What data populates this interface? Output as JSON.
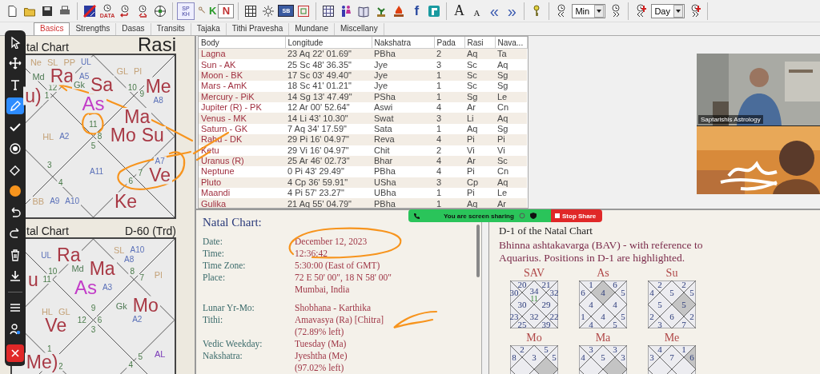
{
  "toolbar": [
    {
      "kind": "new"
    },
    {
      "kind": "open"
    },
    {
      "kind": "save"
    },
    {
      "kind": "print"
    },
    {
      "kind": "separator"
    },
    {
      "kind": "chart"
    },
    {
      "kind": "data",
      "label": "DATA"
    },
    {
      "kind": "clockarrow"
    },
    {
      "kind": "clockarrow2"
    },
    {
      "kind": "wheel"
    },
    {
      "kind": "separator"
    },
    {
      "kind": "badge",
      "label": "SP KH"
    },
    {
      "kind": "key-letter",
      "label": "K"
    },
    {
      "kind": "letter-box",
      "label": "N"
    },
    {
      "kind": "separator"
    },
    {
      "kind": "grid"
    },
    {
      "kind": "sun"
    },
    {
      "kind": "badge-blue",
      "label": "SB"
    },
    {
      "kind": "frame"
    },
    {
      "kind": "separator"
    },
    {
      "kind": "grid2"
    },
    {
      "kind": "people"
    },
    {
      "kind": "book"
    },
    {
      "kind": "plant"
    },
    {
      "kind": "fire"
    },
    {
      "kind": "letter",
      "label": "f"
    },
    {
      "kind": "tile"
    },
    {
      "kind": "separator"
    },
    {
      "kind": "font-large",
      "label": "A"
    },
    {
      "kind": "font-small",
      "label": "A"
    },
    {
      "kind": "chevron-text",
      "label": "«"
    },
    {
      "kind": "chevron-text",
      "label": "»"
    },
    {
      "kind": "separator"
    },
    {
      "kind": "key"
    },
    {
      "kind": "separator"
    },
    {
      "kind": "rewind"
    },
    {
      "kind": "dropdown",
      "value": "Min"
    },
    {
      "kind": "forward"
    },
    {
      "kind": "separator"
    },
    {
      "kind": "rewind-red"
    },
    {
      "kind": "dropdown",
      "value": "Day"
    },
    {
      "kind": "forward-red"
    },
    {
      "kind": "separator"
    }
  ],
  "tabs": [
    {
      "label": "Basics",
      "selected": true
    },
    {
      "label": "Strengths",
      "selected": false
    },
    {
      "label": "Dasas",
      "selected": false
    },
    {
      "label": "Transits",
      "selected": false
    },
    {
      "label": "Tajaka",
      "selected": false
    },
    {
      "label": "Tithi Pravesha",
      "selected": false
    },
    {
      "label": "Mundane",
      "selected": false
    },
    {
      "label": "Miscellany",
      "selected": false
    }
  ],
  "charts": [
    {
      "title": "tal Chart",
      "division": "Rasi",
      "kind": "rasi",
      "houses": [
        {
          "sign": "12",
          "labels": [
            {
              "text": "Ne",
              "kind": "point"
            },
            {
              "text": "SL",
              "kind": "point"
            },
            {
              "text": "PP",
              "kind": "point"
            },
            {
              "text": "UL",
              "kind": "arudha"
            },
            {
              "text": "Md",
              "kind": "upagraha"
            },
            {
              "text": "Ra",
              "kind": "planet"
            },
            {
              "text": "A5",
              "kind": "arudha"
            }
          ]
        },
        {
          "sign": "10",
          "labels": [
            {
              "text": "GL",
              "kind": "point"
            },
            {
              "text": "Pl",
              "kind": "point"
            }
          ]
        },
        {
          "sign": "1",
          "labels": [
            {
              "text": "u)",
              "kind": "planet"
            }
          ]
        },
        {
          "sign": "11",
          "labels": [
            {
              "text": "Gk",
              "kind": "upagraha"
            },
            {
              "text": "Sa",
              "kind": "planet"
            },
            {
              "text": "As",
              "kind": "lagna"
            }
          ]
        },
        {
          "sign": "9",
          "labels": [
            {
              "text": "Me",
              "kind": "planet"
            },
            {
              "text": "A8",
              "kind": "arudha"
            }
          ]
        },
        {
          "labels": [
            {
              "text": "HL",
              "kind": "point"
            },
            {
              "text": "A2",
              "kind": "arudha"
            }
          ]
        },
        {
          "sign": "8",
          "labels": [
            {
              "text": "Ma",
              "kind": "planet"
            },
            {
              "text": "Mo",
              "kind": "planet"
            },
            {
              "text": "Su",
              "kind": "planet"
            }
          ]
        },
        {
          "sign": "3"
        },
        {
          "sign": "5",
          "labels": [
            {
              "text": "A11",
              "kind": "arudha"
            }
          ]
        },
        {
          "sign": "7",
          "labels": [
            {
              "text": "A7",
              "kind": "arudha"
            },
            {
              "text": "Ve",
              "kind": "planet"
            }
          ]
        },
        {
          "sign": "4",
          "labels": [
            {
              "text": "BB",
              "kind": "point"
            },
            {
              "text": "A9",
              "kind": "arudha"
            },
            {
              "text": "A10",
              "kind": "arudha"
            }
          ]
        },
        {
          "sign": "6",
          "labels": [
            {
              "text": "Ke",
              "kind": "planet"
            }
          ]
        }
      ]
    },
    {
      "title": "tal Chart",
      "division": "D-60 (Trd)",
      "kind": "varga",
      "houses": [
        {
          "sign": "10",
          "labels": [
            {
              "text": "UL",
              "kind": "arudha"
            },
            {
              "text": "Ra",
              "kind": "planet"
            }
          ]
        },
        {
          "sign": "8",
          "labels": [
            {
              "text": "SL",
              "kind": "point"
            },
            {
              "text": "A10",
              "kind": "arudha"
            },
            {
              "text": "A8",
              "kind": "arudha"
            }
          ]
        },
        {
          "sign": "11",
          "labels": [
            {
              "text": "u",
              "kind": "planet"
            }
          ]
        },
        {
          "sign": "9",
          "labels": [
            {
              "text": "Md",
              "kind": "upagraha"
            },
            {
              "text": "Ma",
              "kind": "planet"
            },
            {
              "text": "As",
              "kind": "lagna"
            },
            {
              "text": "A3",
              "kind": "arudha"
            }
          ]
        },
        {
          "sign": "7",
          "labels": [
            {
              "text": "Pl",
              "kind": "point"
            }
          ]
        },
        {
          "sign": "12",
          "labels": [
            {
              "text": "HL",
              "kind": "point"
            },
            {
              "text": "GL",
              "kind": "point"
            },
            {
              "text": "Ve",
              "kind": "planet"
            }
          ]
        },
        {
          "sign": "6",
          "labels": [
            {
              "text": "Gk",
              "kind": "upagraha"
            },
            {
              "text": "Mo",
              "kind": "planet"
            },
            {
              "text": "A2",
              "kind": "arudha"
            }
          ]
        },
        {
          "sign": "1",
          "labels": [
            {
              "text": "Me)",
              "kind": "planet"
            }
          ]
        },
        {
          "sign": "3"
        },
        {
          "sign": "5",
          "labels": [
            {
              "text": "AL",
              "kind": "special"
            }
          ]
        },
        {
          "sign": "2"
        },
        {
          "sign": "4"
        }
      ]
    }
  ],
  "table": {
    "columns": [
      "Body",
      "Longitude",
      "Nakshatra",
      "Pada",
      "Rasi",
      "Nava..."
    ],
    "rows": [
      [
        "Lagna",
        "23 Aq 22' 01.69\"",
        "PBha",
        "2",
        "Aq",
        "Ta"
      ],
      [
        "Sun - AK",
        "25 Sc 48' 36.35\"",
        "Jye",
        "3",
        "Sc",
        "Aq"
      ],
      [
        "Moon - BK",
        "17 Sc 03' 49.40\"",
        "Jye",
        "1",
        "Sc",
        "Sg"
      ],
      [
        "Mars - AmK",
        "18 Sc 41' 01.21\"",
        "Jye",
        "1",
        "Sc",
        "Sg"
      ],
      [
        "Mercury - PiK",
        "14 Sg 13' 47.49\"",
        "PSha",
        "1",
        "Sg",
        "Le"
      ],
      [
        "Jupiter (R) - PK",
        "12 Ar 00' 52.64\"",
        "Aswi",
        "4",
        "Ar",
        "Cn"
      ],
      [
        "Venus - MK",
        "14 Li 43' 10.30\"",
        "Swat",
        "3",
        "Li",
        "Aq"
      ],
      [
        "Saturn - GK",
        "7 Aq 34' 17.59\"",
        "Sata",
        "1",
        "Aq",
        "Sg"
      ],
      [
        "Rahu - DK",
        "29 Pi 16' 04.97\"",
        "Reva",
        "4",
        "Pi",
        "Pi"
      ],
      [
        "Ketu",
        "29 Vi 16' 04.97\"",
        "Chit",
        "2",
        "Vi",
        "Vi"
      ],
      [
        "Uranus (R)",
        "25 Ar 46' 02.73\"",
        "Bhar",
        "4",
        "Ar",
        "Sc"
      ],
      [
        "Neptune",
        "0 Pi 43' 29.49\"",
        "PBha",
        "4",
        "Pi",
        "Cn"
      ],
      [
        "Pluto",
        "4 Cp 36' 59.91\"",
        "USha",
        "3",
        "Cp",
        "Aq"
      ],
      [
        "Maandi",
        "4 Pi 57' 23.27\"",
        "UBha",
        "1",
        "Pi",
        "Le"
      ],
      [
        "Gulika",
        "21 Aq 55' 04.79\"",
        "PBha",
        "1",
        "Aq",
        "Ar"
      ]
    ]
  },
  "details": {
    "title": "Natal Chart:",
    "sections": [
      {
        "rows": [
          {
            "label": "Date:",
            "values": [
              "December 12, 2023"
            ]
          },
          {
            "label": "Time:",
            "values": [
              "12:36:42"
            ]
          },
          {
            "label": "Time Zone:",
            "values": [
              "5:30:00 (East of GMT)"
            ]
          },
          {
            "label": "Place:",
            "values": [
              "72 E 50' 00\", 18 N 58' 00\"",
              "Mumbai, India"
            ]
          }
        ]
      },
      {
        "rows": [
          {
            "label": "Lunar Yr-Mo:",
            "values": [
              "Shobhana - Karthika"
            ]
          },
          {
            "label": "Tithi:",
            "values": [
              "Amavasya (Ra) [Chitra]",
              "(72.89% left)"
            ]
          },
          {
            "label": "Vedic Weekday:",
            "values": [
              "Tuesday (Ma)"
            ]
          },
          {
            "label": "Nakshatra:",
            "values": [
              "Jyeshtha (Me)",
              "(97.02% left)"
            ]
          }
        ]
      }
    ]
  },
  "bav": {
    "title": "D-1 of the Natal Chart",
    "description": "Bhinna ashtakavarga (BAV) - with reference to Aquarius. Positions in D-1 are highlighted.",
    "charts": [
      {
        "name": "SAV",
        "sign_mark": "11",
        "houses": [
          {
            "value": "20",
            "highlighted": false
          },
          {
            "value": "21",
            "highlighted": false
          },
          {
            "value": "30",
            "highlighted": false
          },
          {
            "value": "34",
            "highlighted": false
          },
          {
            "value": "32",
            "highlighted": false
          },
          {
            "value": "30",
            "highlighted": false
          },
          {
            "value": "29",
            "highlighted": false
          },
          {
            "value": "23",
            "highlighted": false
          },
          {
            "value": "32",
            "highlighted": false
          },
          {
            "value": "22",
            "highlighted": false
          },
          {
            "value": "25",
            "highlighted": false
          },
          {
            "value": "39",
            "highlighted": false
          }
        ]
      },
      {
        "name": "As",
        "houses": [
          {
            "value": "1",
            "highlighted": false
          },
          {
            "value": "6",
            "highlighted": false
          },
          {
            "value": "6",
            "highlighted": false
          },
          {
            "value": "4",
            "highlighted": true
          },
          {
            "value": "5",
            "highlighted": false
          },
          {
            "value": "4",
            "highlighted": false
          },
          {
            "value": "4",
            "highlighted": false
          },
          {
            "value": "1",
            "highlighted": false
          },
          {
            "value": "4",
            "highlighted": false
          },
          {
            "value": "5",
            "highlighted": false
          },
          {
            "value": "4",
            "highlighted": false
          },
          {
            "value": "5",
            "highlighted": false
          }
        ]
      },
      {
        "name": "Su",
        "houses": [
          {
            "value": "2",
            "highlighted": false
          },
          {
            "value": "2",
            "highlighted": false
          },
          {
            "value": "4",
            "highlighted": false
          },
          {
            "value": "5",
            "highlighted": false
          },
          {
            "value": "5",
            "highlighted": false
          },
          {
            "value": "5",
            "highlighted": false
          },
          {
            "value": "5",
            "highlighted": true
          },
          {
            "value": "2",
            "highlighted": false
          },
          {
            "value": "6",
            "highlighted": false
          },
          {
            "value": "2",
            "highlighted": false
          },
          {
            "value": "3",
            "highlighted": false
          },
          {
            "value": "7",
            "highlighted": false
          }
        ]
      },
      {
        "name": "Mo",
        "houses": [
          {
            "value": "2",
            "highlighted": false
          },
          {
            "value": "5",
            "highlighted": false
          },
          {
            "value": "8",
            "highlighted": false
          },
          {
            "value": "3",
            "highlighted": false
          },
          {
            "value": "5",
            "highlighted": false
          },
          {
            "highlighted": false
          },
          {
            "highlighted": true
          },
          {
            "highlighted": false
          },
          {
            "highlighted": false
          },
          {
            "highlighted": false
          }
        ]
      },
      {
        "name": "Ma",
        "houses": [
          {
            "value": "3",
            "highlighted": false
          },
          {
            "value": "3",
            "highlighted": false
          },
          {
            "value": "4",
            "highlighted": false
          },
          {
            "value": "5",
            "highlighted": false
          },
          {
            "value": "3",
            "highlighted": false
          },
          {
            "highlighted": false
          },
          {
            "highlighted": true
          },
          {
            "highlighted": false
          },
          {
            "highlighted": false
          },
          {
            "highlighted": false
          }
        ]
      },
      {
        "name": "Me",
        "houses": [
          {
            "value": "4",
            "highlighted": false
          },
          {
            "value": "1",
            "highlighted": false
          },
          {
            "value": "3",
            "highlighted": false
          },
          {
            "value": "7",
            "highlighted": false
          },
          {
            "value": "6",
            "highlighted": true
          },
          {
            "highlighted": false
          },
          {
            "highlighted": false
          },
          {
            "highlighted": false
          },
          {
            "highlighted": false
          },
          {
            "highlighted": false
          }
        ]
      }
    ]
  },
  "annotation_toolbar": {
    "tools": [
      {
        "kind": "select",
        "selected": false
      },
      {
        "kind": "move",
        "selected": false
      },
      {
        "kind": "text",
        "selected": false
      },
      {
        "kind": "pen",
        "selected": true
      },
      {
        "kind": "stamp",
        "selected": false
      },
      {
        "kind": "spotlight",
        "selected": false
      },
      {
        "kind": "eraser",
        "selected": false
      },
      {
        "kind": "color",
        "color": "#f7941d",
        "selected": false
      },
      {
        "kind": "undo",
        "selected": false
      },
      {
        "kind": "redo",
        "selected": false
      },
      {
        "kind": "clear",
        "selected": false
      },
      {
        "kind": "save",
        "selected": false
      },
      {
        "kind": "separator"
      },
      {
        "kind": "menu",
        "selected": false
      },
      {
        "kind": "participants",
        "selected": false
      },
      {
        "kind": "close"
      }
    ]
  },
  "video_panel": {
    "tiles": [
      {
        "kind": "picture",
        "caption": "Saptarishis Astrology"
      },
      {
        "kind": "picture"
      }
    ]
  },
  "share_bar": {
    "text": "You are screen sharing",
    "stop_button": "Stop Share"
  }
}
